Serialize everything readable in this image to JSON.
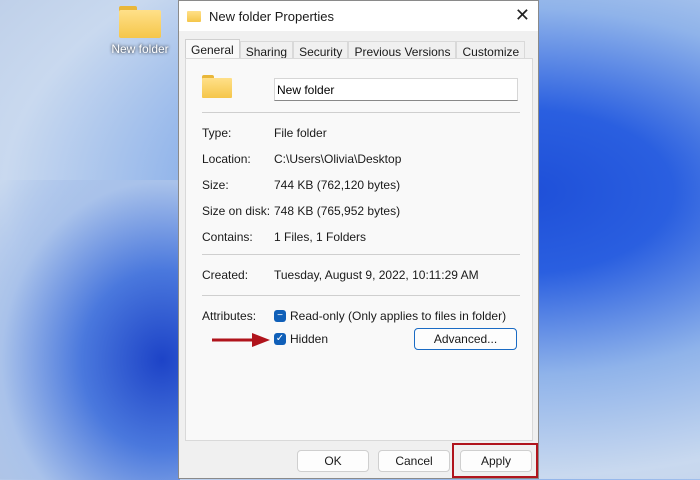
{
  "desktop": {
    "icon_label": "New folder"
  },
  "dialog": {
    "title": "New folder Properties",
    "tabs": [
      "General",
      "Sharing",
      "Security",
      "Previous Versions",
      "Customize"
    ],
    "name_value": "New folder",
    "fields": [
      {
        "label": "Type:",
        "value": "File folder"
      },
      {
        "label": "Location:",
        "value": "C:\\Users\\Olivia\\Desktop"
      },
      {
        "label": "Size:",
        "value": "744 KB (762,120 bytes)"
      },
      {
        "label": "Size on disk:",
        "value": "748 KB (765,952 bytes)"
      },
      {
        "label": "Contains:",
        "value": "1 Files, 1 Folders"
      },
      {
        "label": "Created:",
        "value": "Tuesday, August 9, 2022, 10:11:29 AM"
      }
    ],
    "attributes_label": "Attributes:",
    "readonly_label": "Read-only (Only applies to files in folder)",
    "readonly_state": "indeterminate",
    "hidden_label": "Hidden",
    "hidden_checked": true,
    "advanced_label": "Advanced...",
    "ok_label": "OK",
    "cancel_label": "Cancel",
    "apply_label": "Apply"
  },
  "colors": {
    "accent": "#0f5fb8",
    "highlight": "#b0141c"
  }
}
